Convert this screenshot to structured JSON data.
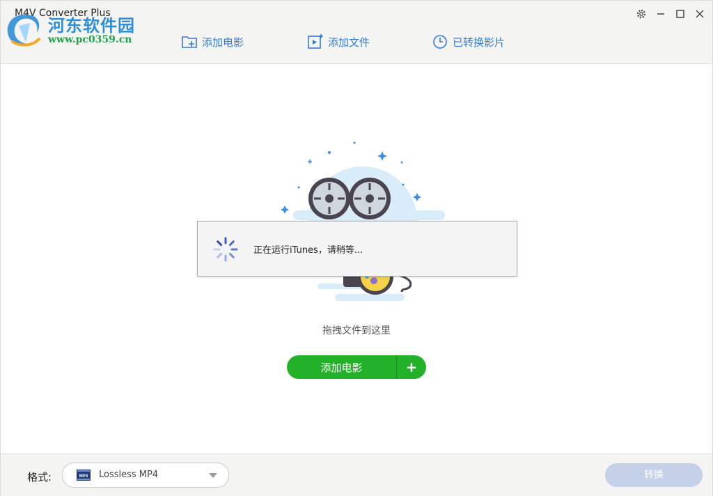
{
  "window": {
    "title": "M4V Converter Plus"
  },
  "watermark": {
    "site_name": "河东软件园",
    "url": "www.pc0359.cn"
  },
  "toolbar": {
    "add_movie": "添加电影",
    "add_file": "添加文件",
    "converted": "已转换影片"
  },
  "window_controls": [
    "settings",
    "minimize",
    "maximize",
    "close"
  ],
  "main": {
    "drop_hint": "拖拽文件到这里",
    "add_button_label": "添加电影",
    "add_button_plus": "+"
  },
  "dialog": {
    "message": "正在运行iTunes，请稍等..."
  },
  "footer": {
    "format_label": "格式:",
    "format_icon_text": "MP4",
    "format_value": "Lossless MP4",
    "convert_label": "转换"
  },
  "colors": {
    "accent_blue": "#2f7bd6",
    "primary_green": "#23b12a",
    "disabled_button": "#c5d1e8"
  }
}
